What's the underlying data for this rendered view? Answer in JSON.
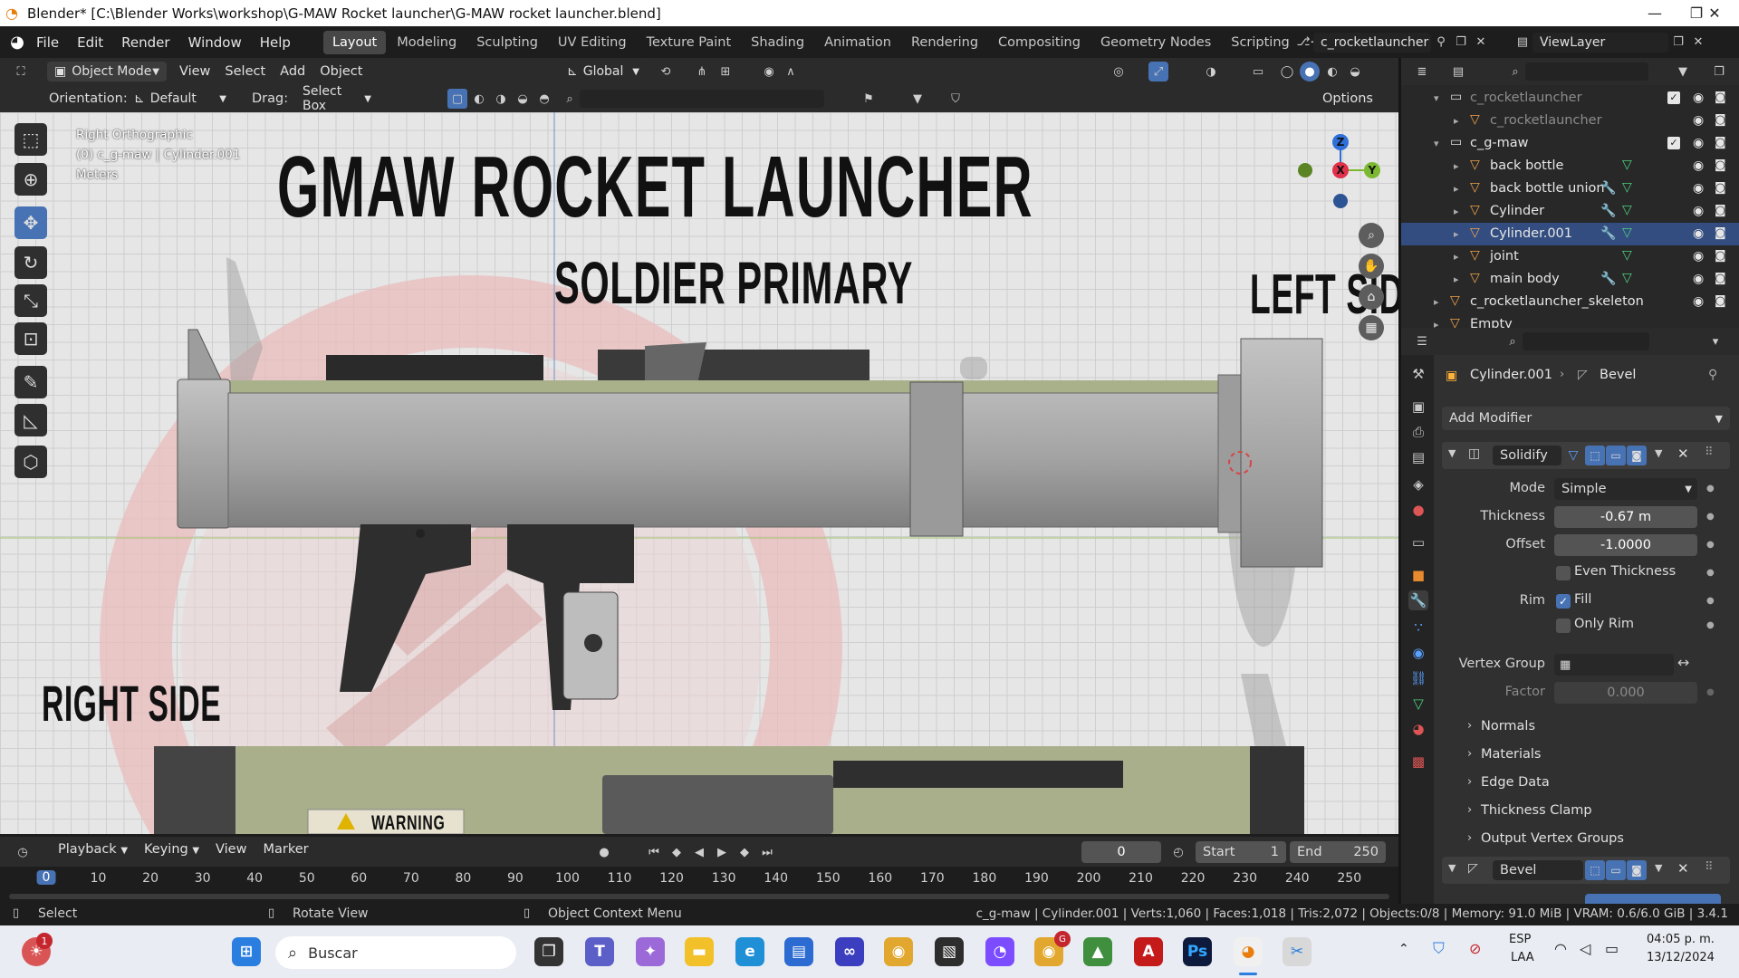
{
  "window": {
    "title": "Blender* [C:\\Blender Works\\workshop\\G-MAW Rocket launcher\\G-MAW rocket launcher.blend]",
    "minimize": "—",
    "maximize": "❐",
    "close": "✕"
  },
  "menu": [
    "File",
    "Edit",
    "Render",
    "Window",
    "Help"
  ],
  "workspaces": [
    "Layout",
    "Modeling",
    "Sculpting",
    "UV Editing",
    "Texture Paint",
    "Shading",
    "Animation",
    "Rendering",
    "Compositing",
    "Geometry Nodes",
    "Scripting"
  ],
  "active_workspace": "Layout",
  "scene": {
    "name": "c_rocketlauncher",
    "view_layer": "ViewLayer"
  },
  "viewport_header": {
    "mode": "Object Mode",
    "view": "View",
    "select": "Select",
    "add": "Add",
    "object": "Object",
    "transform_orientation": "Global"
  },
  "tool_settings": {
    "orientation_label": "Orientation:",
    "orientation": "Default",
    "drag_label": "Drag:",
    "drag": "Select Box",
    "options": "Options"
  },
  "viewport_overlay": {
    "view_name": "Right Orthographic",
    "context": "(0) c_g-maw | Cylinder.001",
    "units": "Meters"
  },
  "gizmo": {
    "z": "Z",
    "y": "Y",
    "x": "X"
  },
  "reference_image": {
    "title": "GMAW ROCKET LAUNCHER",
    "subtitle": "SOLDIER PRIMARY",
    "left_label": "LEFT SID",
    "right_label": "RIGHT SIDE",
    "warning": "WARNING"
  },
  "outliner": {
    "rows": [
      {
        "label": "c_rocketlauncher",
        "type": "collection",
        "dim": true
      },
      {
        "label": "c_rocketlauncher",
        "type": "object",
        "dim": true
      },
      {
        "label": "c_g-maw",
        "type": "collection",
        "dim": false
      },
      {
        "label": "back bottle",
        "type": "object",
        "dim": false
      },
      {
        "label": "back bottle union",
        "type": "object",
        "dim": false
      },
      {
        "label": "Cylinder",
        "type": "object",
        "dim": false
      },
      {
        "label": "Cylinder.001",
        "type": "object",
        "dim": false
      },
      {
        "label": "joint",
        "type": "object",
        "dim": false
      },
      {
        "label": "main body",
        "type": "object",
        "dim": false
      },
      {
        "label": "c_rocketlauncher_skeleton",
        "type": "object",
        "dim": false
      },
      {
        "label": "Empty",
        "type": "object",
        "dim": false
      }
    ]
  },
  "properties": {
    "object_name": "Cylinder.001",
    "breadcrumb_modifier": "Bevel",
    "add_modifier": "Add Modifier",
    "modifier_1": {
      "name": "Solidify",
      "mode_label": "Mode",
      "mode": "Simple",
      "thickness_label": "Thickness",
      "thickness": "-0.67 m",
      "offset_label": "Offset",
      "offset": "-1.0000",
      "even_thickness": "Even Thickness",
      "rim_label": "Rim",
      "fill": "Fill",
      "only_rim": "Only Rim",
      "vertex_group_label": "Vertex Group",
      "factor_label": "Factor",
      "factor": "0.000",
      "subpanels": [
        "Normals",
        "Materials",
        "Edge Data",
        "Thickness Clamp",
        "Output Vertex Groups"
      ]
    },
    "modifier_2": {
      "name": "Bevel"
    }
  },
  "timeline": {
    "playback": "Playback",
    "keying": "Keying",
    "view": "View",
    "marker": "Marker",
    "current_frame": "0",
    "start_label": "Start",
    "start": "1",
    "end_label": "End",
    "end": "250",
    "ticks": [
      "0",
      "10",
      "20",
      "30",
      "40",
      "50",
      "60",
      "70",
      "80",
      "90",
      "100",
      "110",
      "120",
      "130",
      "140",
      "150",
      "160",
      "170",
      "180",
      "190",
      "200",
      "210",
      "220",
      "230",
      "240",
      "250"
    ]
  },
  "statusbar": {
    "select": "Select",
    "rotate": "Rotate View",
    "context_menu": "Object Context Menu",
    "stats": "c_g-maw | Cylinder.001 | Verts:1,060 | Faces:1,018 | Tris:2,072 | Objects:0/8 | Memory: 91.0 MiB | VRAM: 0.6/6.0 GiB | 3.4.1"
  },
  "taskbar": {
    "search": "Buscar",
    "lang": "ESP",
    "lang2": "LAA",
    "time": "04:05 p. m.",
    "date": "13/12/2024",
    "notification_badge": "1",
    "chrome_badge": "G"
  },
  "colors": {
    "accent_blue": "#4772b3",
    "orange": "#e87d0d",
    "viewport_bg": "#e6e6e6"
  }
}
